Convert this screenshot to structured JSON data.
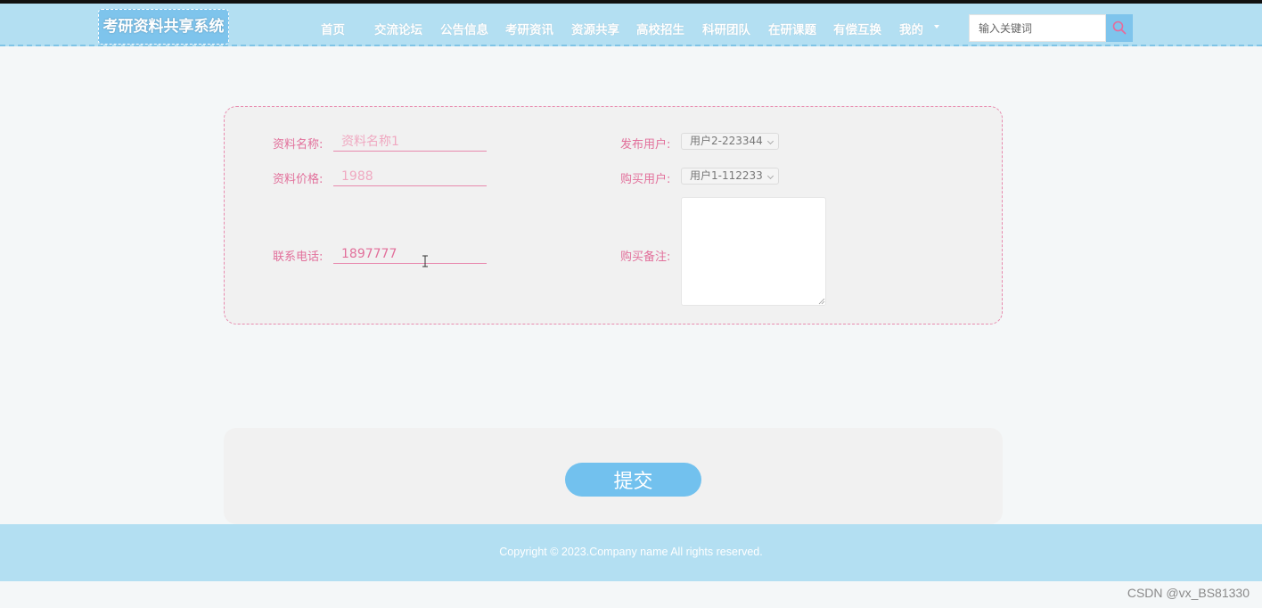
{
  "header": {
    "logo": "考研资料共享系统",
    "nav": [
      {
        "label": "首页"
      },
      {
        "label": "交流论坛"
      },
      {
        "label": "公告信息"
      },
      {
        "label": "考研资讯"
      },
      {
        "label": "资源共享"
      },
      {
        "label": "高校招生"
      },
      {
        "label": "科研团队"
      },
      {
        "label": "在研课题"
      },
      {
        "label": "有偿互换"
      },
      {
        "label": "我的"
      }
    ],
    "search_placeholder": "输入关键词"
  },
  "form": {
    "name_label": "资料名称:",
    "name_placeholder": "资料名称1",
    "price_label": "资料价格:",
    "price_value": "1988",
    "phone_label": "联系电话:",
    "phone_value": "1897777",
    "publisher_label": "发布用户:",
    "publisher_value": "用户2-223344",
    "buyer_label": "购买用户:",
    "buyer_value": "用户1-112233",
    "remark_label": "购买备注:",
    "remark_value": ""
  },
  "submit_label": "提交",
  "footer": {
    "copyright": "Copyright © 2023.Company name All rights reserved."
  },
  "watermark": "CSDN @vx_BS81330",
  "colors": {
    "header_bg": "#b3dff2",
    "accent_blue": "#72c1ee",
    "label_pink": "#e2709b",
    "card_bg": "#f1f1f1"
  },
  "icons": [
    "search-icon",
    "chevron-down-icon",
    "resize-grip-icon",
    "text-cursor-icon"
  ]
}
